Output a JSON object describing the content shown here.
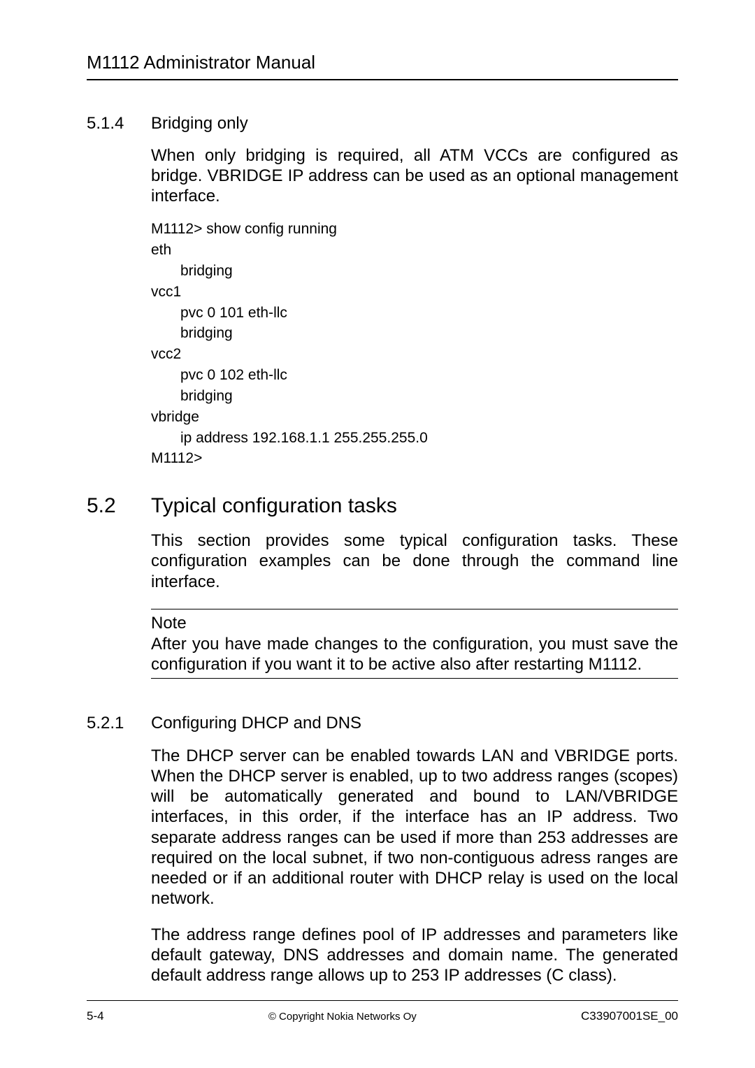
{
  "header": {
    "title": "M1112 Administrator Manual"
  },
  "s514": {
    "num": "5.1.4",
    "title": "Bridging only",
    "para": "When only bridging is required, all ATM VCCs are configured as bridge. VBRIDGE IP address can be used as an optional management interface.",
    "code": {
      "l1": "M1112> show config running",
      "l2": "eth",
      "l3": "bridging",
      "l4": "vcc1",
      "l5": "pvc 0 101 eth-llc",
      "l6": "bridging",
      "l7": "vcc2",
      "l8": "pvc 0 102 eth-llc",
      "l9": "bridging",
      "l10": "vbridge",
      "l11": "ip address 192.168.1.1 255.255.255.0",
      "l12": "M1112>"
    }
  },
  "s52": {
    "num": "5.2",
    "title": "Typical configuration tasks",
    "para": "This section provides some typical configuration tasks. These configuration examples can be done through the command line interface.",
    "note_label": "Note",
    "note_body": "After you have made changes to the configuration, you must save the configuration if you want it to be active also after restarting M1112."
  },
  "s521": {
    "num": "5.2.1",
    "title": "Configuring DHCP and DNS",
    "p1": "The DHCP server can be enabled towards LAN and VBRIDGE ports. When the DHCP server is enabled, up to two address ranges (scopes) will be automatically generated and bound to LAN/VBRIDGE interfaces, in this order, if the interface has an IP address. Two separate address ranges can be used if more than 253 addresses are required on the local subnet, if two non-contiguous adress ranges are needed or if an additional router with DHCP relay is used on the local network.",
    "p2": "The address range defines pool of IP addresses and parameters like default gateway, DNS addresses and domain name. The generated default address range allows up to 253 IP addresses (C class)."
  },
  "footer": {
    "left": "5-4",
    "mid": "© Copyright Nokia Networks Oy",
    "right": "C33907001SE_00"
  }
}
